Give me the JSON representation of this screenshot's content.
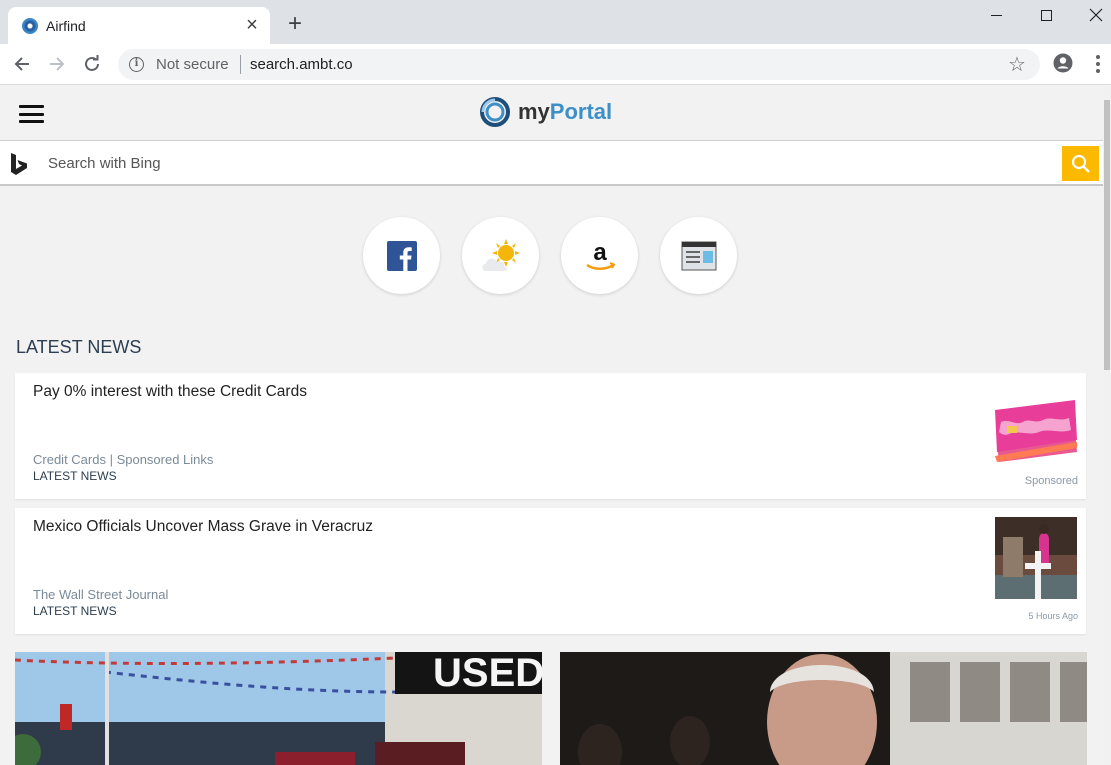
{
  "browser": {
    "tab_title": "Airfind",
    "security_label": "Not secure",
    "url": "search.ambt.co"
  },
  "site": {
    "logo_my": "my",
    "logo_portal": "Portal",
    "search_placeholder": "Search with Bing",
    "quick_links": [
      {
        "name": "facebook",
        "icon": "facebook-icon"
      },
      {
        "name": "weather",
        "icon": "weather-icon"
      },
      {
        "name": "amazon",
        "icon": "amazon-icon"
      },
      {
        "name": "news",
        "icon": "news-icon"
      }
    ],
    "section_title": "LATEST NEWS",
    "news": [
      {
        "title": "Pay 0% interest with these Credit Cards",
        "source": "Credit Cards | Sponsored Links",
        "category": "LATEST NEWS",
        "meta": "Sponsored"
      },
      {
        "title": "Mexico Officials Uncover Mass Grave in Veracruz",
        "source": "The Wall Street Journal",
        "category": "LATEST NEWS",
        "meta": "5 Hours Ago"
      }
    ],
    "feature_sign_text": "USED"
  },
  "colors": {
    "accent": "#fbb900",
    "logo_blue": "#3d8fc7",
    "text_dark": "#2c3e50"
  }
}
